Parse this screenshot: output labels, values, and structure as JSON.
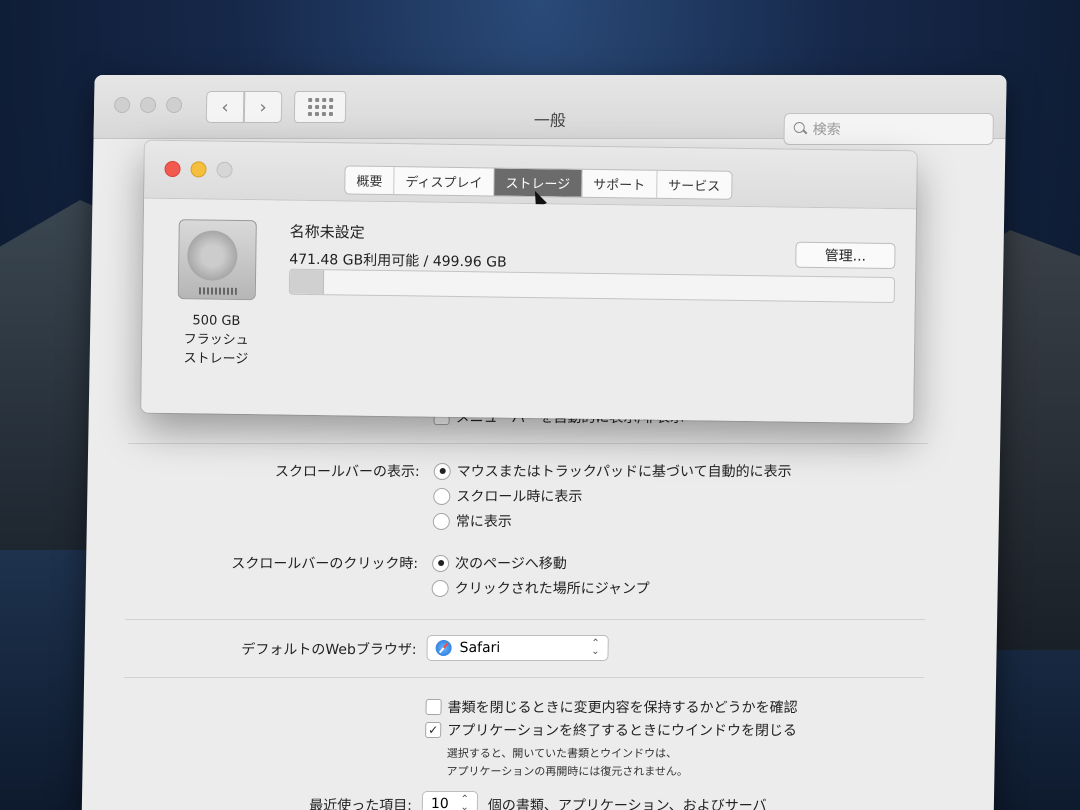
{
  "prefs": {
    "title": "一般",
    "search_placeholder": "検索",
    "nav_back": "‹",
    "nav_forward": "›",
    "menubar_hidden_option": "メニューバーを自動的に表示/非表示",
    "scrollbar_show_label": "スクロールバーの表示:",
    "scrollbar_show_options": [
      {
        "label": "マウスまたはトラックパッドに基づいて自動的に表示",
        "selected": true
      },
      {
        "label": "スクロール時に表示",
        "selected": false
      },
      {
        "label": "常に表示",
        "selected": false
      }
    ],
    "scrollbar_click_label": "スクロールバーのクリック時:",
    "scrollbar_click_options": [
      {
        "label": "次のページへ移動",
        "selected": true
      },
      {
        "label": "クリックされた場所にジャンプ",
        "selected": false
      }
    ],
    "default_browser_label": "デフォルトのWebブラウザ:",
    "default_browser_value": "Safari",
    "ask_keep_changes": {
      "label": "書類を閉じるときに変更内容を保持するかどうかを確認",
      "checked": false
    },
    "close_windows": {
      "label": "アプリケーションを終了するときにウインドウを閉じる",
      "checked": true
    },
    "close_windows_note": [
      "選択すると、開いていた書類とウインドウは、",
      "アプリケーションの再開時には復元されません。"
    ],
    "recent_items_label": "最近使った項目:",
    "recent_items_value": "10",
    "recent_items_suffix": "個の書類、アプリケーション、およびサーバ"
  },
  "about": {
    "tabs": [
      {
        "label": "概要",
        "active": false
      },
      {
        "label": "ディスプレイ",
        "active": false
      },
      {
        "label": "ストレージ",
        "active": true
      },
      {
        "label": "サポート",
        "active": false
      },
      {
        "label": "サービス",
        "active": false
      }
    ],
    "disk_caption": [
      "500 GB",
      "フラッシュ",
      "ストレージ"
    ],
    "volume_name": "名称未設定",
    "volume_available": "471.48 GB利用可能 / 499.96 GB",
    "used_fraction": 0.057,
    "manage_button": "管理..."
  },
  "colors": {
    "close": "#f25a50",
    "minimize": "#f5be3c",
    "active_tab": "#6b6b6b"
  }
}
